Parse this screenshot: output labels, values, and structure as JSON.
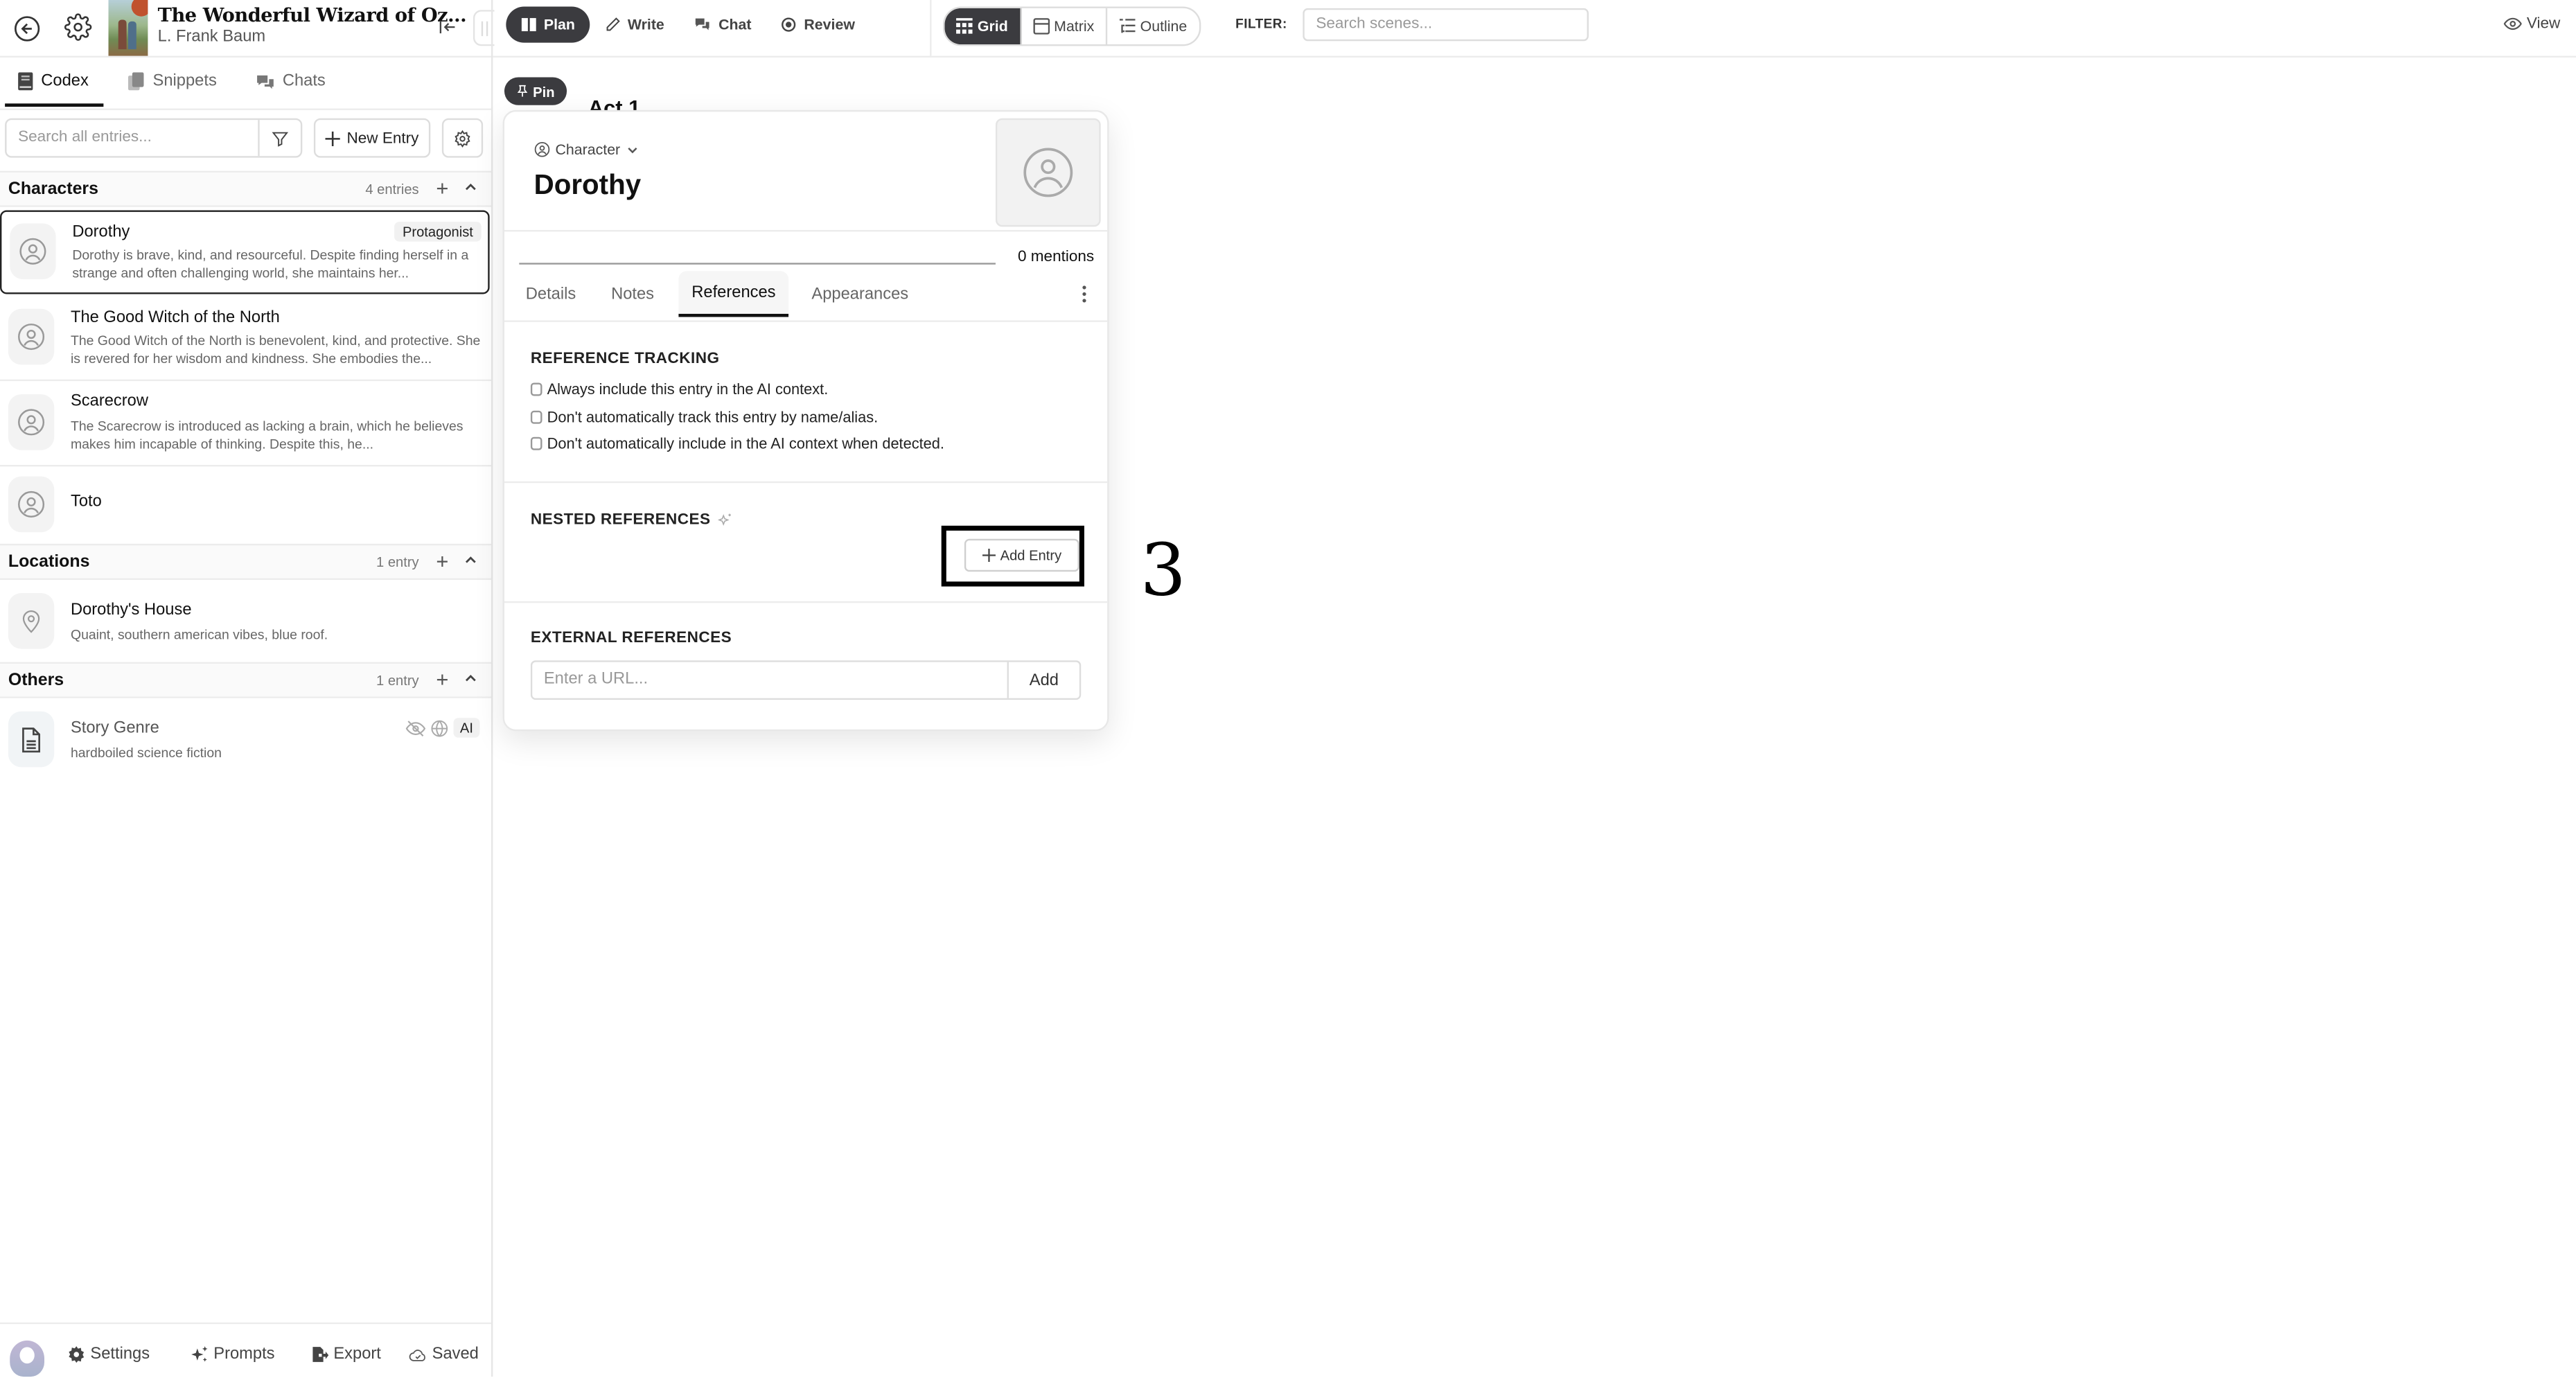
{
  "topbar": {
    "book_title": "The Wonderful Wizard of Oz...",
    "author": "L. Frank Baum",
    "modes": [
      {
        "label": "Plan",
        "icon": "columns-icon",
        "active": true
      },
      {
        "label": "Write",
        "icon": "pen-icon",
        "active": false
      },
      {
        "label": "Chat",
        "icon": "chat-icon",
        "active": false
      },
      {
        "label": "Review",
        "icon": "review-icon",
        "active": false
      }
    ],
    "views": [
      {
        "label": "Grid",
        "icon": "grid-icon",
        "active": true
      },
      {
        "label": "Matrix",
        "icon": "matrix-icon",
        "active": false
      },
      {
        "label": "Outline",
        "icon": "outline-icon",
        "active": false
      }
    ],
    "filter_label": "FILTER:",
    "scene_search_placeholder": "Search scenes...",
    "view_label": "View"
  },
  "sidebar": {
    "tabs": [
      {
        "label": "Codex",
        "active": true
      },
      {
        "label": "Snippets",
        "active": false
      },
      {
        "label": "Chats",
        "active": false
      }
    ],
    "search_placeholder": "Search all entries...",
    "new_entry_label": "New Entry",
    "groups": [
      {
        "title": "Characters",
        "count": "4 entries",
        "entries": [
          {
            "name": "Dorothy",
            "badge": "Protagonist",
            "description": "Dorothy is brave, kind, and resourceful. Despite finding herself in a strange and often challenging world, she maintains her...",
            "selected": true
          },
          {
            "name": "The Good Witch of the North",
            "description": "The Good Witch of the North is benevolent, kind, and protective. She is revered for her wisdom and kindness. She embodies the..."
          },
          {
            "name": "Scarecrow",
            "description": "The Scarecrow is introduced as lacking a brain, which he believes makes him incapable of thinking. Despite this, he..."
          },
          {
            "name": "Toto",
            "description": ""
          }
        ]
      },
      {
        "title": "Locations",
        "count": "1 entry",
        "entries": [
          {
            "name": "Dorothy's House",
            "description": "Quaint, southern american vibes, blue roof."
          }
        ]
      },
      {
        "title": "Others",
        "count": "1 entry",
        "entries": [
          {
            "name": "Story Genre",
            "description": "hardboiled science fiction",
            "ai_badge": "AI"
          }
        ]
      }
    ],
    "bottom": {
      "settings_label": "Settings",
      "prompts_label": "Prompts",
      "export_label": "Export",
      "saved_label": "Saved"
    }
  },
  "main": {
    "pin_label": "Pin",
    "act_title": "Act 1"
  },
  "popover": {
    "type_label": "Character",
    "name": "Dorothy",
    "mentions": "0 mentions",
    "tabs": [
      {
        "label": "Details",
        "active": false
      },
      {
        "label": "Notes",
        "active": false
      },
      {
        "label": "References",
        "active": true
      },
      {
        "label": "Appearances",
        "active": false
      }
    ],
    "reference_tracking": {
      "title": "REFERENCE TRACKING",
      "options": [
        {
          "label": "Always include this entry in the AI context.",
          "checked": false
        },
        {
          "label": "Don't automatically track this entry by name/alias.",
          "checked": false
        },
        {
          "label": "Don't automatically include in the AI context when detected.",
          "checked": false
        }
      ]
    },
    "nested_references": {
      "title": "NESTED REFERENCES",
      "add_entry_label": "Add Entry"
    },
    "external_references": {
      "title": "EXTERNAL REFERENCES",
      "url_placeholder": "Enter a URL...",
      "add_label": "Add"
    }
  },
  "annotation": {
    "number": "3"
  }
}
